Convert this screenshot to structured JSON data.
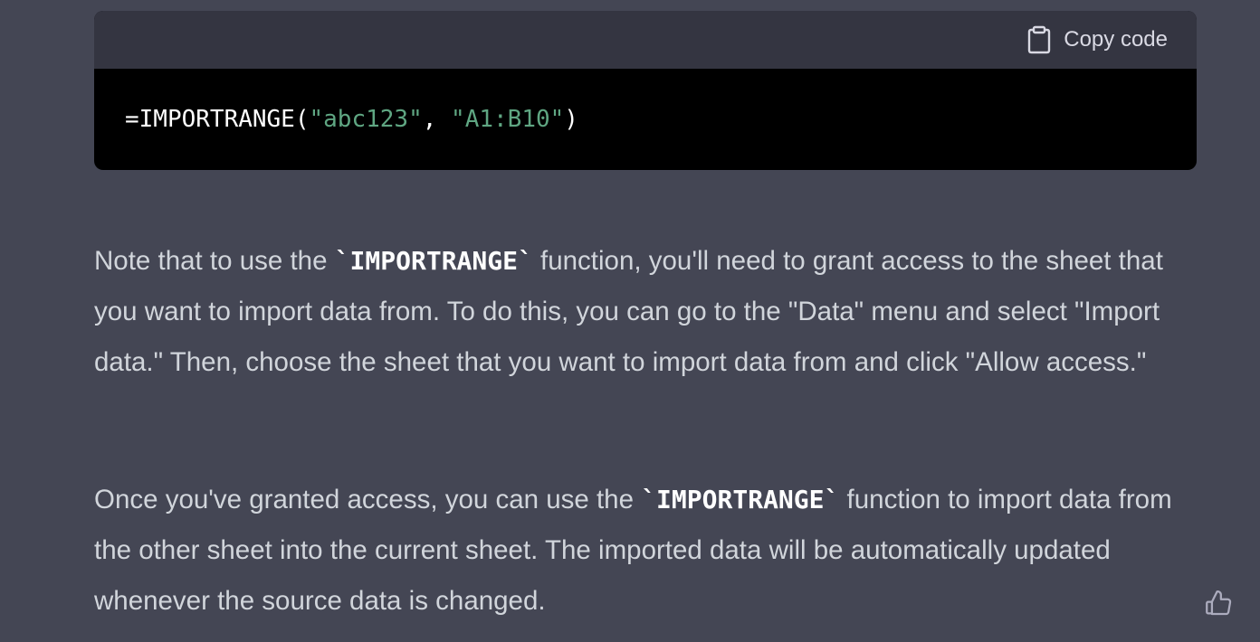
{
  "code_block": {
    "copy_label": "Copy code",
    "copy_icon": "clipboard-icon",
    "code": {
      "func": "=IMPORTRANGE(",
      "arg1": "\"abc123\"",
      "sep": ", ",
      "arg2": "\"A1:B10\"",
      "close": ")"
    }
  },
  "paragraphs": [
    {
      "before": "Note that to use the ",
      "code": "`IMPORTRANGE`",
      "after": " function, you'll need to grant access to the sheet that you want to import data from. To do this, you can go to the \"Data\" menu and select \"Import data.\" Then, choose the sheet that you want to import data from and click \"Allow access.\""
    },
    {
      "before": "Once you've granted access, you can use the ",
      "code": "`IMPORTRANGE`",
      "after": " function to import data from the other sheet into the current sheet. The imported data will be automatically updated whenever the source data is changed."
    }
  ],
  "feedback": {
    "icon": "thumbs-up-icon"
  },
  "colors": {
    "background": "#444654",
    "code_header": "#343541",
    "code_body": "#000000",
    "string": "#5fa682",
    "text": "#d1d5db"
  }
}
